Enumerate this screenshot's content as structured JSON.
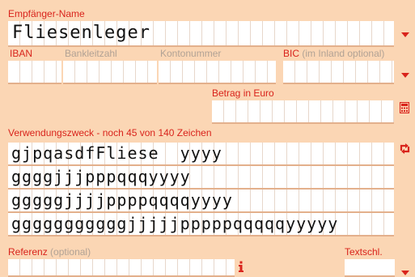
{
  "recipient": {
    "label": "Empfänger-Name",
    "value": "Fliesenleger"
  },
  "bank": {
    "iban_label": "IBAN",
    "blz_label": "Bankleitzahl",
    "account_label": "Kontonummer",
    "bic_label": "BIC",
    "bic_hint": "(im Inland optional)"
  },
  "amount": {
    "label": "Betrag in Euro",
    "value": ""
  },
  "purpose": {
    "label": "Verwendungszweck - noch 45 von 140 Zeichen",
    "lines": [
      "gjpqasdfFliese  yyyy",
      "ggggjjjpppqqqyyyy",
      "gggggjjjjppppqqqqyyyy",
      "gggggggggggjjjjjpppppqqqqqyyyyy"
    ]
  },
  "reference": {
    "label": "Referenz",
    "hint": "(optional)",
    "value": ""
  },
  "text_key": {
    "label": "Textschl."
  },
  "icons": {
    "calculator": "calculator-icon",
    "swap": "swap-icon",
    "info": "info-icon",
    "dropdown": "chevron-down-icon"
  },
  "colors": {
    "background": "#fbd6b4",
    "accent": "#d9241c",
    "muted": "#b1a295"
  }
}
